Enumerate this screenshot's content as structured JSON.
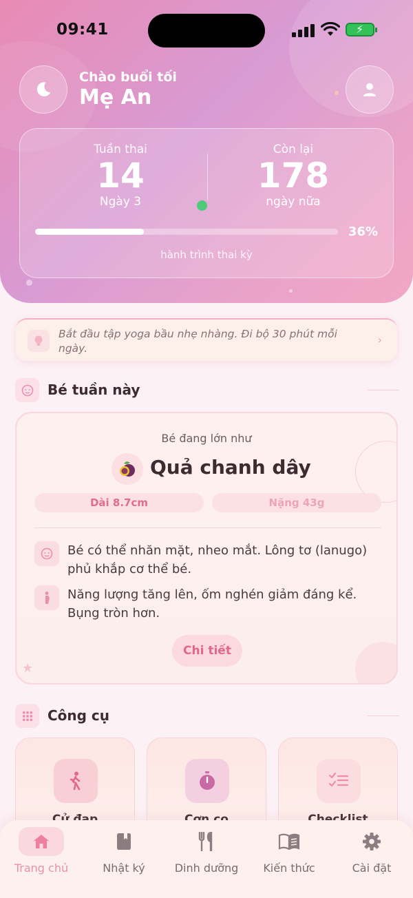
{
  "status_bar": {
    "time": "09:41"
  },
  "header": {
    "greeting": "Chào buổi tối",
    "name": "Mẹ An",
    "theme_icon": "moon-icon",
    "profile_icon": "user-icon"
  },
  "stats": {
    "week_label": "Tuần thai",
    "week_value": "14",
    "day_label": "Ngày 3",
    "remaining_label": "Còn lại",
    "remaining_value": "178",
    "remaining_unit": "ngày nữa",
    "progress_percent": 36,
    "progress_text": "36%",
    "journey_label": "hành trình thai kỳ"
  },
  "tip": {
    "text": "Bắt đầu tập yoga bầu nhẹ nhàng. Đi bộ 30 phút mỗi ngày.",
    "icon": "lightbulb-icon"
  },
  "baby_section": {
    "title": "Bé tuần này",
    "grow_label": "Bé đang lớn như",
    "fruit_name": "Quả chanh dây",
    "fruit_icon": "passion-fruit-icon",
    "length": "Dài 8.7cm",
    "weight": "Nặng 43g",
    "facts": [
      {
        "icon": "baby-face-icon",
        "text": "Bé có thể nhăn mặt, nheo mắt. Lông tơ (lanugo) phủ khắp cơ thể bé."
      },
      {
        "icon": "pregnant-icon",
        "text": "Năng lượng tăng lên, ốm nghén giảm đáng kể. Bụng tròn hơn."
      }
    ],
    "detail_button": "Chi tiết"
  },
  "tools_section": {
    "title": "Công cụ",
    "tools": [
      {
        "label": "Cử đạp",
        "icon": "walking-icon"
      },
      {
        "label": "Cơn co",
        "icon": "timer-icon"
      },
      {
        "label": "Checklist",
        "icon": "checklist-icon"
      }
    ]
  },
  "nav": {
    "items": [
      {
        "label": "Trang chủ",
        "icon": "home-icon",
        "active": true
      },
      {
        "label": "Nhật ký",
        "icon": "diary-icon",
        "active": false
      },
      {
        "label": "Dinh dưỡng",
        "icon": "cutlery-icon",
        "active": false
      },
      {
        "label": "Kiến thức",
        "icon": "book-icon",
        "active": false
      },
      {
        "label": "Cài đặt",
        "icon": "gear-icon",
        "active": false
      }
    ]
  },
  "colors": {
    "accent": "#e98fae",
    "hero_start": "#e98bb4",
    "hero_end": "#f1a6c5",
    "progress_dot": "#4fc97a"
  }
}
